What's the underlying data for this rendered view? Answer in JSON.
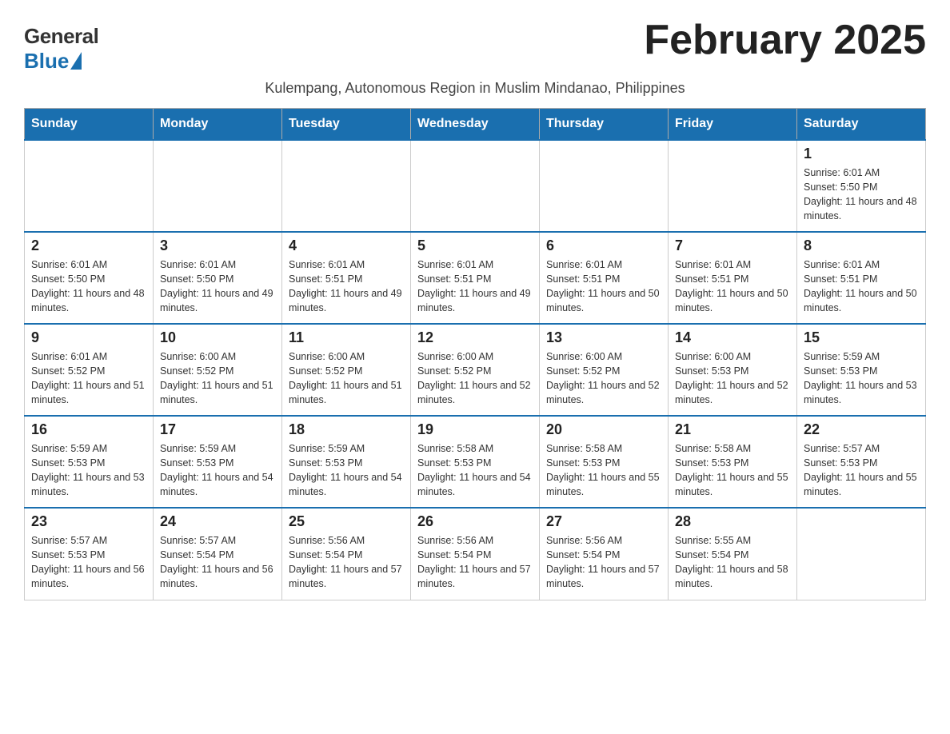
{
  "logo": {
    "general": "General",
    "blue": "Blue"
  },
  "title": "February 2025",
  "subtitle": "Kulempang, Autonomous Region in Muslim Mindanao, Philippines",
  "days_of_week": [
    "Sunday",
    "Monday",
    "Tuesday",
    "Wednesday",
    "Thursday",
    "Friday",
    "Saturday"
  ],
  "weeks": [
    [
      {
        "day": "",
        "sunrise": "",
        "sunset": "",
        "daylight": ""
      },
      {
        "day": "",
        "sunrise": "",
        "sunset": "",
        "daylight": ""
      },
      {
        "day": "",
        "sunrise": "",
        "sunset": "",
        "daylight": ""
      },
      {
        "day": "",
        "sunrise": "",
        "sunset": "",
        "daylight": ""
      },
      {
        "day": "",
        "sunrise": "",
        "sunset": "",
        "daylight": ""
      },
      {
        "day": "",
        "sunrise": "",
        "sunset": "",
        "daylight": ""
      },
      {
        "day": "1",
        "sunrise": "Sunrise: 6:01 AM",
        "sunset": "Sunset: 5:50 PM",
        "daylight": "Daylight: 11 hours and 48 minutes."
      }
    ],
    [
      {
        "day": "2",
        "sunrise": "Sunrise: 6:01 AM",
        "sunset": "Sunset: 5:50 PM",
        "daylight": "Daylight: 11 hours and 48 minutes."
      },
      {
        "day": "3",
        "sunrise": "Sunrise: 6:01 AM",
        "sunset": "Sunset: 5:50 PM",
        "daylight": "Daylight: 11 hours and 49 minutes."
      },
      {
        "day": "4",
        "sunrise": "Sunrise: 6:01 AM",
        "sunset": "Sunset: 5:51 PM",
        "daylight": "Daylight: 11 hours and 49 minutes."
      },
      {
        "day": "5",
        "sunrise": "Sunrise: 6:01 AM",
        "sunset": "Sunset: 5:51 PM",
        "daylight": "Daylight: 11 hours and 49 minutes."
      },
      {
        "day": "6",
        "sunrise": "Sunrise: 6:01 AM",
        "sunset": "Sunset: 5:51 PM",
        "daylight": "Daylight: 11 hours and 50 minutes."
      },
      {
        "day": "7",
        "sunrise": "Sunrise: 6:01 AM",
        "sunset": "Sunset: 5:51 PM",
        "daylight": "Daylight: 11 hours and 50 minutes."
      },
      {
        "day": "8",
        "sunrise": "Sunrise: 6:01 AM",
        "sunset": "Sunset: 5:51 PM",
        "daylight": "Daylight: 11 hours and 50 minutes."
      }
    ],
    [
      {
        "day": "9",
        "sunrise": "Sunrise: 6:01 AM",
        "sunset": "Sunset: 5:52 PM",
        "daylight": "Daylight: 11 hours and 51 minutes."
      },
      {
        "day": "10",
        "sunrise": "Sunrise: 6:00 AM",
        "sunset": "Sunset: 5:52 PM",
        "daylight": "Daylight: 11 hours and 51 minutes."
      },
      {
        "day": "11",
        "sunrise": "Sunrise: 6:00 AM",
        "sunset": "Sunset: 5:52 PM",
        "daylight": "Daylight: 11 hours and 51 minutes."
      },
      {
        "day": "12",
        "sunrise": "Sunrise: 6:00 AM",
        "sunset": "Sunset: 5:52 PM",
        "daylight": "Daylight: 11 hours and 52 minutes."
      },
      {
        "day": "13",
        "sunrise": "Sunrise: 6:00 AM",
        "sunset": "Sunset: 5:52 PM",
        "daylight": "Daylight: 11 hours and 52 minutes."
      },
      {
        "day": "14",
        "sunrise": "Sunrise: 6:00 AM",
        "sunset": "Sunset: 5:53 PM",
        "daylight": "Daylight: 11 hours and 52 minutes."
      },
      {
        "day": "15",
        "sunrise": "Sunrise: 5:59 AM",
        "sunset": "Sunset: 5:53 PM",
        "daylight": "Daylight: 11 hours and 53 minutes."
      }
    ],
    [
      {
        "day": "16",
        "sunrise": "Sunrise: 5:59 AM",
        "sunset": "Sunset: 5:53 PM",
        "daylight": "Daylight: 11 hours and 53 minutes."
      },
      {
        "day": "17",
        "sunrise": "Sunrise: 5:59 AM",
        "sunset": "Sunset: 5:53 PM",
        "daylight": "Daylight: 11 hours and 54 minutes."
      },
      {
        "day": "18",
        "sunrise": "Sunrise: 5:59 AM",
        "sunset": "Sunset: 5:53 PM",
        "daylight": "Daylight: 11 hours and 54 minutes."
      },
      {
        "day": "19",
        "sunrise": "Sunrise: 5:58 AM",
        "sunset": "Sunset: 5:53 PM",
        "daylight": "Daylight: 11 hours and 54 minutes."
      },
      {
        "day": "20",
        "sunrise": "Sunrise: 5:58 AM",
        "sunset": "Sunset: 5:53 PM",
        "daylight": "Daylight: 11 hours and 55 minutes."
      },
      {
        "day": "21",
        "sunrise": "Sunrise: 5:58 AM",
        "sunset": "Sunset: 5:53 PM",
        "daylight": "Daylight: 11 hours and 55 minutes."
      },
      {
        "day": "22",
        "sunrise": "Sunrise: 5:57 AM",
        "sunset": "Sunset: 5:53 PM",
        "daylight": "Daylight: 11 hours and 55 minutes."
      }
    ],
    [
      {
        "day": "23",
        "sunrise": "Sunrise: 5:57 AM",
        "sunset": "Sunset: 5:53 PM",
        "daylight": "Daylight: 11 hours and 56 minutes."
      },
      {
        "day": "24",
        "sunrise": "Sunrise: 5:57 AM",
        "sunset": "Sunset: 5:54 PM",
        "daylight": "Daylight: 11 hours and 56 minutes."
      },
      {
        "day": "25",
        "sunrise": "Sunrise: 5:56 AM",
        "sunset": "Sunset: 5:54 PM",
        "daylight": "Daylight: 11 hours and 57 minutes."
      },
      {
        "day": "26",
        "sunrise": "Sunrise: 5:56 AM",
        "sunset": "Sunset: 5:54 PM",
        "daylight": "Daylight: 11 hours and 57 minutes."
      },
      {
        "day": "27",
        "sunrise": "Sunrise: 5:56 AM",
        "sunset": "Sunset: 5:54 PM",
        "daylight": "Daylight: 11 hours and 57 minutes."
      },
      {
        "day": "28",
        "sunrise": "Sunrise: 5:55 AM",
        "sunset": "Sunset: 5:54 PM",
        "daylight": "Daylight: 11 hours and 58 minutes."
      },
      {
        "day": "",
        "sunrise": "",
        "sunset": "",
        "daylight": ""
      }
    ]
  ]
}
